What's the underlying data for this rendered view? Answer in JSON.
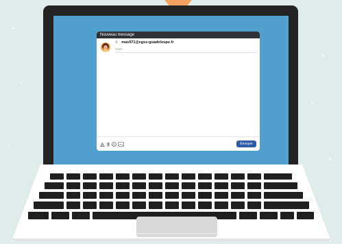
{
  "compose": {
    "header_title": "Nouveau message",
    "to_prefix": "A",
    "to_value": "mas971@cgss-guadeloupe.fr",
    "subject_placeholder": "Objet",
    "send_label": "Envoyer"
  },
  "icons": [
    "format-text-icon",
    "attachment-icon",
    "emoji-icon",
    "image-icon"
  ],
  "colors": {
    "background": "#dfece9",
    "accent_arrow": "#f4a15f",
    "screen": "#4f9fcf",
    "laptop_frame": "#232323",
    "compose_header": "#2f3337",
    "send_button": "#2e5aa8"
  }
}
